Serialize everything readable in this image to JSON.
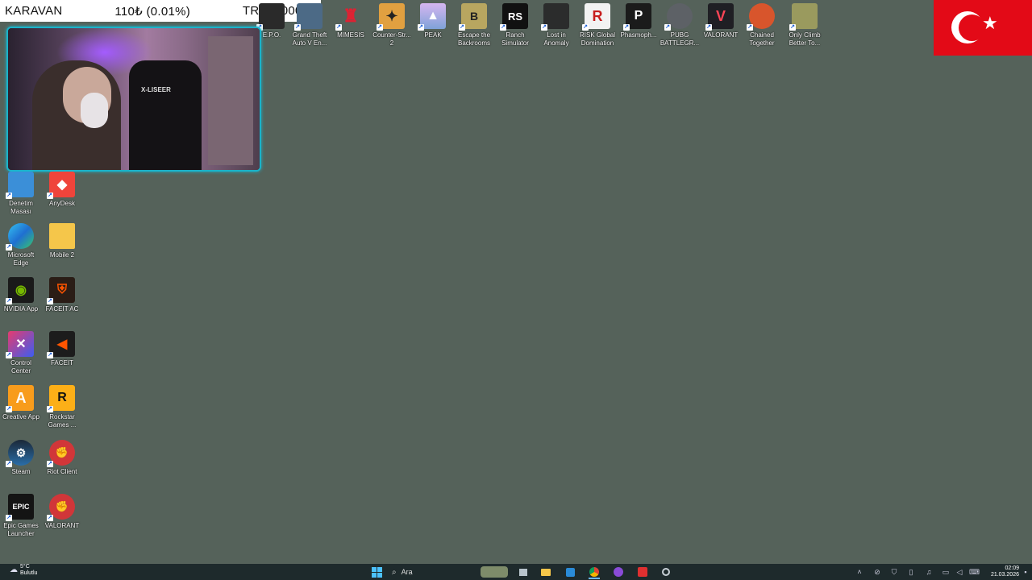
{
  "overlay": {
    "name": "KARAVAN",
    "balance": "110₺ (0.01%)",
    "goal": "TRY1000000"
  },
  "desktop_top_icons": [
    {
      "label": "E.P.O."
    },
    {
      "label": "Grand Theft Auto V En..."
    },
    {
      "label": "MIMESIS"
    },
    {
      "label": "Counter-Str... 2"
    },
    {
      "label": "PEAK"
    },
    {
      "label": "Escape the Backrooms"
    },
    {
      "label": "Ranch Simulator"
    },
    {
      "label": "Lost in Anomaly"
    },
    {
      "label": "RISK Global Domination"
    },
    {
      "label": "Phasmoph..."
    },
    {
      "label": "PUBG BATTLEGR..."
    },
    {
      "label": "VALORANT"
    },
    {
      "label": "Chained Together"
    },
    {
      "label": "Only Climb Better To..."
    }
  ],
  "desktop_left_icons": [
    {
      "label": "Denetim Masası"
    },
    {
      "label": "AnyDesk"
    },
    {
      "label": "Microsoft Edge"
    },
    {
      "label": "Mobile 2"
    },
    {
      "label": "NVIDIA App"
    },
    {
      "label": "FACEIT AC"
    },
    {
      "label": "Control Center"
    },
    {
      "label": "FACEIT"
    },
    {
      "label": "Creative App"
    },
    {
      "label": "Rockstar Games ..."
    },
    {
      "label": "Steam"
    },
    {
      "label": "Riot Client"
    },
    {
      "label": "Epic Games Launcher"
    },
    {
      "label": "VALORANT"
    }
  ],
  "webcam": {
    "chair_brand": "X-LISEER"
  },
  "taskbar": {
    "weather_temp": "5°C",
    "weather_desc": "Bulutlu",
    "search_placeholder": "Ara",
    "time": "02:09",
    "date": "21.03.2026"
  },
  "colors": {
    "desktop_bg": "#55625a",
    "webcam_border": "#1ab3c9",
    "flag_red": "#e30a17"
  }
}
